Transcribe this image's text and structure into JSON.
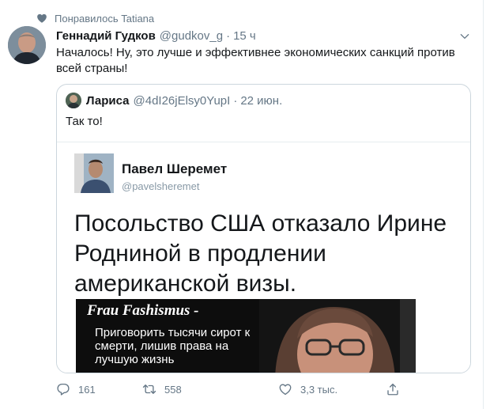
{
  "social_context": {
    "text": "Понравилось Tatiana"
  },
  "tweet": {
    "author_name": "Геннадий Гудков",
    "handle": "@gudkov_g",
    "separator": "·",
    "time": "15 ч",
    "text": "Началось! Ну, это лучше и эффективнее экономических санкций против всей страны!"
  },
  "quoted_tweet": {
    "author_name": "Лариса",
    "handle": "@4dI26jElsy0YupI",
    "separator": "·",
    "time": "22 июн.",
    "text": "Так то!"
  },
  "embedded_screenshot": {
    "author_name": "Павел Шеремет",
    "handle": "@pavelsheremet",
    "headline": "Посольство США отказало Ирине Родниной в продлении американской визы.",
    "photo_title": "Frau Fashismus -",
    "photo_text": "Приговорить тысячи сирот к смерти, лишив права на лучшую жизнь"
  },
  "actions": {
    "reply_count": "161",
    "retweet_count": "558",
    "like_count": "3,3 тыс."
  },
  "icons": {
    "heart": "heart-icon",
    "caret": "chevron-down-icon",
    "reply": "reply-icon",
    "retweet": "retweet-icon",
    "like": "like-icon",
    "share": "share-icon"
  },
  "colors": {
    "text_primary": "#14171a",
    "text_secondary": "#657786",
    "border": "#ccd6dd"
  }
}
